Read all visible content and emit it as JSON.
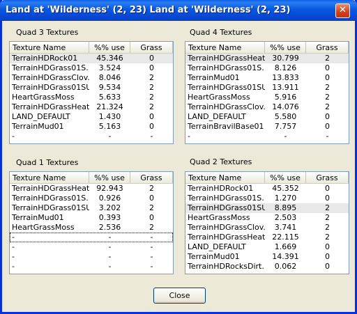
{
  "window": {
    "title": "Land at 'Wilderness' (2, 23) Land at 'Wilderness' (2, 23)",
    "close_glyph": "✕"
  },
  "columns": {
    "name": "Texture Name",
    "use": "%% use",
    "grass": "Grass"
  },
  "quad3": {
    "label": "Quad 3 Textures",
    "rows": [
      {
        "name": "TerrainHDRock01",
        "use": "45.346",
        "grass": "0"
      },
      {
        "name": "TerrainHDGrass01S...",
        "use": "3.524",
        "grass": "0"
      },
      {
        "name": "TerrainHDGrassClov...",
        "use": "8.046",
        "grass": "2"
      },
      {
        "name": "TerrainHDGrass01SU",
        "use": "9.534",
        "grass": "2"
      },
      {
        "name": "HeartGrassMoss",
        "use": "5.633",
        "grass": "2"
      },
      {
        "name": "TerrainHDGrassHeat...",
        "use": "21.324",
        "grass": "2"
      },
      {
        "name": "LAND_DEFAULT",
        "use": "1.430",
        "grass": "0"
      },
      {
        "name": "TerrainMud01",
        "use": "5.163",
        "grass": "0"
      },
      {
        "name": "-",
        "use": "-",
        "grass": "-"
      }
    ]
  },
  "quad4": {
    "label": "Quad 4 Textures",
    "rows": [
      {
        "name": "TerrainHDGrassHeat...",
        "use": "30.799",
        "grass": "2"
      },
      {
        "name": "TerrainHDGrass01S...",
        "use": "8.126",
        "grass": "0"
      },
      {
        "name": "TerrainMud01",
        "use": "13.833",
        "grass": "0"
      },
      {
        "name": "TerrainHDGrass01SU",
        "use": "13.911",
        "grass": "2"
      },
      {
        "name": "HeartGrassMoss",
        "use": "5.916",
        "grass": "2"
      },
      {
        "name": "TerrainHDGrassClov...",
        "use": "14.076",
        "grass": "2"
      },
      {
        "name": "LAND_DEFAULT",
        "use": "5.580",
        "grass": "0"
      },
      {
        "name": "TerrainBravilBase01",
        "use": "7.757",
        "grass": "0"
      },
      {
        "name": "-",
        "use": "-",
        "grass": "-"
      }
    ]
  },
  "quad1": {
    "label": "Quad 1 Textures",
    "rows": [
      {
        "name": "TerrainHDGrassHeat...",
        "use": "92.943",
        "grass": "2"
      },
      {
        "name": "TerrainHDGrass01S...",
        "use": "0.926",
        "grass": "0"
      },
      {
        "name": "TerrainHDGrass01SU",
        "use": "3.202",
        "grass": "2"
      },
      {
        "name": "TerrainMud01",
        "use": "0.393",
        "grass": "0"
      },
      {
        "name": "HeartGrassMoss",
        "use": "2.536",
        "grass": "2"
      },
      {
        "name": "-",
        "use": "-",
        "grass": "-"
      },
      {
        "name": "-",
        "use": "-",
        "grass": "-"
      },
      {
        "name": "-",
        "use": "-",
        "grass": "-"
      },
      {
        "name": "-",
        "use": "-",
        "grass": "-"
      }
    ]
  },
  "quad2": {
    "label": "Quad 2 Textures",
    "rows": [
      {
        "name": "TerrainHDRock01",
        "use": "45.352",
        "grass": "0"
      },
      {
        "name": "TerrainHDGrass01S...",
        "use": "1.270",
        "grass": "0"
      },
      {
        "name": "TerrainHDGrass01SU",
        "use": "8.895",
        "grass": "2"
      },
      {
        "name": "HeartGrassMoss",
        "use": "2.503",
        "grass": "2"
      },
      {
        "name": "TerrainHDGrassClov...",
        "use": "3.741",
        "grass": "2"
      },
      {
        "name": "TerrainHDGrassHeat...",
        "use": "22.115",
        "grass": "2"
      },
      {
        "name": "LAND_DEFAULT",
        "use": "1.669",
        "grass": "0"
      },
      {
        "name": "TerrainMud01",
        "use": "14.391",
        "grass": "0"
      },
      {
        "name": "TerrainHDRocksDirt...",
        "use": "0.062",
        "grass": "0"
      }
    ]
  },
  "buttons": {
    "close": "Close"
  }
}
